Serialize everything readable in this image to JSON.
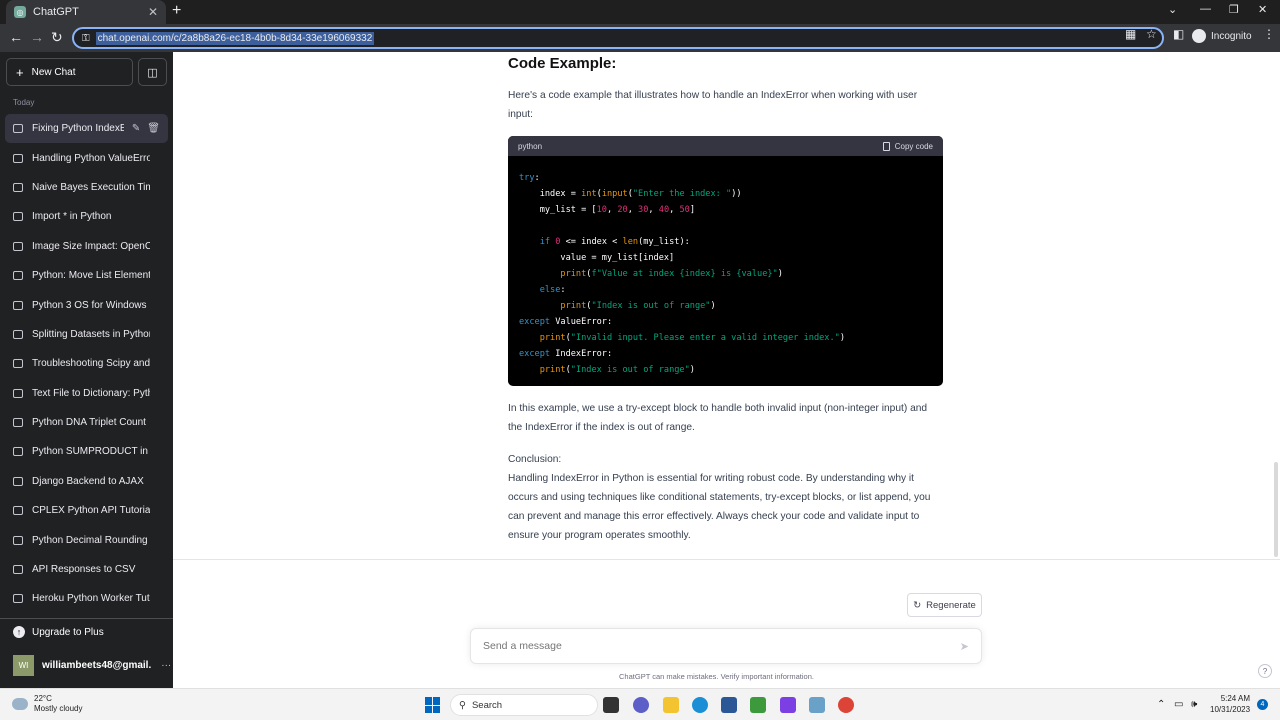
{
  "browser": {
    "tab_title": "ChatGPT",
    "url": "chat.openai.com/c/2a8b8a26-ec18-4b0b-8d34-33e196069332",
    "incognito_label": "Incognito"
  },
  "sidebar": {
    "new_chat_label": "New Chat",
    "section_label": "Today",
    "items": [
      {
        "label": "Fixing Python IndexError"
      },
      {
        "label": "Handling Python ValueError"
      },
      {
        "label": "Naive Bayes Execution Time"
      },
      {
        "label": "Import * in Python"
      },
      {
        "label": "Image Size Impact: OpenCV"
      },
      {
        "label": "Python: Move List Elements"
      },
      {
        "label": "Python 3 OS for Windows"
      },
      {
        "label": "Splitting Datasets in Python"
      },
      {
        "label": "Troubleshooting Scipy and S"
      },
      {
        "label": "Text File to Dictionary: Pytho"
      },
      {
        "label": "Python DNA Triplet Count"
      },
      {
        "label": "Python SUMPRODUCT in Ne"
      },
      {
        "label": "Django Backend to AJAX"
      },
      {
        "label": "CPLEX Python API Tutorial"
      },
      {
        "label": "Python Decimal Rounding Tu"
      },
      {
        "label": "API Responses to CSV"
      },
      {
        "label": "Heroku Python Worker Tutor"
      }
    ],
    "upgrade_label": "Upgrade to Plus",
    "user_initials": "WI",
    "user_email": "williambeets48@gmail."
  },
  "message": {
    "heading": "Code Example:",
    "intro": "Here's a code example that illustrates how to handle an IndexError when working with user input:",
    "code_lang": "python",
    "copy_label": "Copy code",
    "explanation": "In this example, we use a try-except block to handle both invalid input (non-integer input) and the IndexError if the index is out of range.",
    "conclusion_title": "Conclusion:",
    "conclusion": "Handling IndexError in Python is essential for writing robust code. By understanding why it occurs and using techniques like conditional statements, try-except blocks, or list append, you can prevent and manage this error effectively. Always check your code and validate input to ensure your program operates smoothly."
  },
  "composer": {
    "regenerate_label": "Regenerate",
    "placeholder": "Send a message",
    "disclaimer": "ChatGPT can make mistakes. Verify important information.",
    "help": "?"
  },
  "taskbar": {
    "temp": "22°C",
    "weather": "Mostly cloudy",
    "search_label": "Search",
    "time": "5:24 AM",
    "date": "10/31/2023",
    "notif_count": "4"
  }
}
